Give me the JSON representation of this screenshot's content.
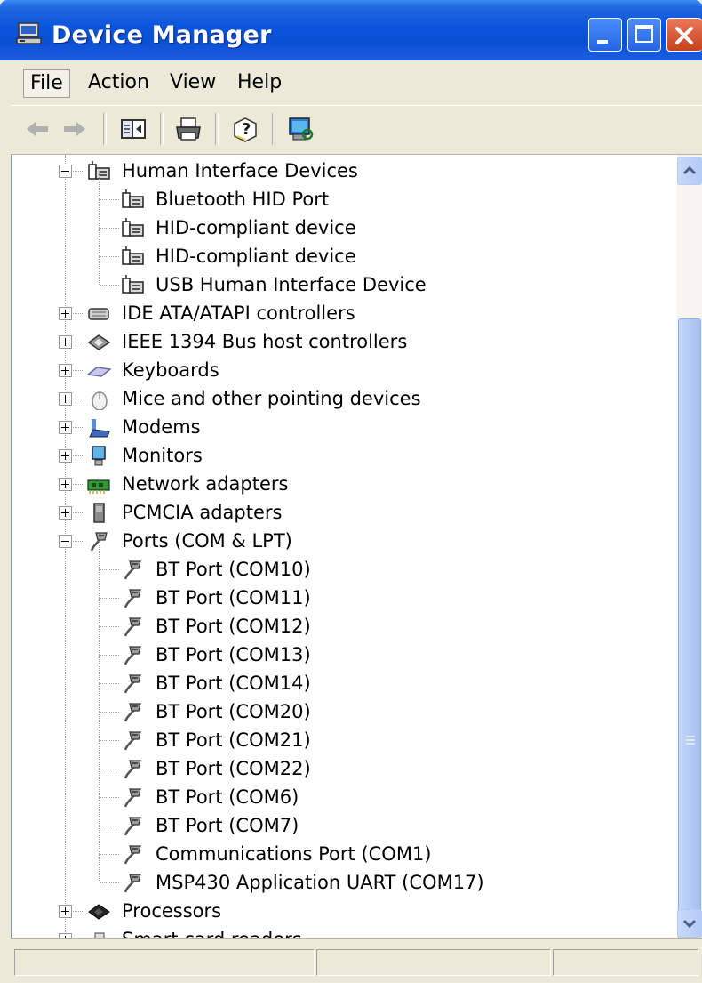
{
  "window": {
    "title": "Device Manager",
    "icon": "device-manager-icon",
    "buttons": [
      "minimize",
      "maximize",
      "close"
    ]
  },
  "menu": {
    "items": [
      {
        "label": "File",
        "mnemonic": "F"
      },
      {
        "label": "Action",
        "mnemonic": "A"
      },
      {
        "label": "View",
        "mnemonic": "V"
      },
      {
        "label": "Help",
        "mnemonic": "H"
      }
    ]
  },
  "toolbar": {
    "items": [
      "back-icon",
      "forward-icon",
      "show-hide-console-tree-icon",
      "print-icon",
      "help-icon",
      "scan-hardware-icon"
    ]
  },
  "tree": {
    "rows": [
      {
        "label": "Human Interface Devices",
        "level": 1,
        "expander": "-",
        "icon": "hid-icon"
      },
      {
        "label": "Bluetooth HID Port",
        "level": 2,
        "icon": "hid-icon"
      },
      {
        "label": "HID-compliant device",
        "level": 2,
        "icon": "hid-icon"
      },
      {
        "label": "HID-compliant device",
        "level": 2,
        "icon": "hid-icon"
      },
      {
        "label": "USB Human Interface Device",
        "level": 2,
        "icon": "hid-icon"
      },
      {
        "label": "IDE ATA/ATAPI controllers",
        "level": 1,
        "expander": "+",
        "icon": "ide-controller-icon"
      },
      {
        "label": "IEEE 1394 Bus host controllers",
        "level": 1,
        "expander": "+",
        "icon": "ieee1394-icon"
      },
      {
        "label": "Keyboards",
        "level": 1,
        "expander": "+",
        "icon": "keyboard-icon"
      },
      {
        "label": "Mice and other pointing devices",
        "level": 1,
        "expander": "+",
        "icon": "mouse-icon"
      },
      {
        "label": "Modems",
        "level": 1,
        "expander": "+",
        "icon": "modem-icon"
      },
      {
        "label": "Monitors",
        "level": 1,
        "expander": "+",
        "icon": "monitor-icon"
      },
      {
        "label": "Network adapters",
        "level": 1,
        "expander": "+",
        "icon": "network-adapter-icon"
      },
      {
        "label": "PCMCIA adapters",
        "level": 1,
        "expander": "+",
        "icon": "pcmcia-icon"
      },
      {
        "label": "Ports (COM & LPT)",
        "level": 1,
        "expander": "-",
        "icon": "port-icon"
      },
      {
        "label": "BT Port (COM10)",
        "level": 2,
        "icon": "port-icon"
      },
      {
        "label": "BT Port (COM11)",
        "level": 2,
        "icon": "port-icon"
      },
      {
        "label": "BT Port (COM12)",
        "level": 2,
        "icon": "port-icon"
      },
      {
        "label": "BT Port (COM13)",
        "level": 2,
        "icon": "port-icon"
      },
      {
        "label": "BT Port (COM14)",
        "level": 2,
        "icon": "port-icon"
      },
      {
        "label": "BT Port (COM20)",
        "level": 2,
        "icon": "port-icon"
      },
      {
        "label": "BT Port (COM21)",
        "level": 2,
        "icon": "port-icon"
      },
      {
        "label": "BT Port (COM22)",
        "level": 2,
        "icon": "port-icon"
      },
      {
        "label": "BT Port (COM6)",
        "level": 2,
        "icon": "port-icon"
      },
      {
        "label": "BT Port (COM7)",
        "level": 2,
        "icon": "port-icon"
      },
      {
        "label": "Communications Port (COM1)",
        "level": 2,
        "icon": "port-icon"
      },
      {
        "label": "MSP430 Application UART (COM17)",
        "level": 2,
        "icon": "port-icon"
      },
      {
        "label": "Processors",
        "level": 1,
        "expander": "+",
        "icon": "processor-icon"
      },
      {
        "label": "Smart card readers",
        "level": 1,
        "expander": "+",
        "icon": "smart-card-reader-icon"
      }
    ]
  },
  "scrollbar": {
    "position_fraction": 0.2,
    "visible_fraction": 0.85
  },
  "colors": {
    "titlebar": "#0a55dc",
    "chrome": "#ece9d8",
    "close_button": "#d6512a"
  }
}
